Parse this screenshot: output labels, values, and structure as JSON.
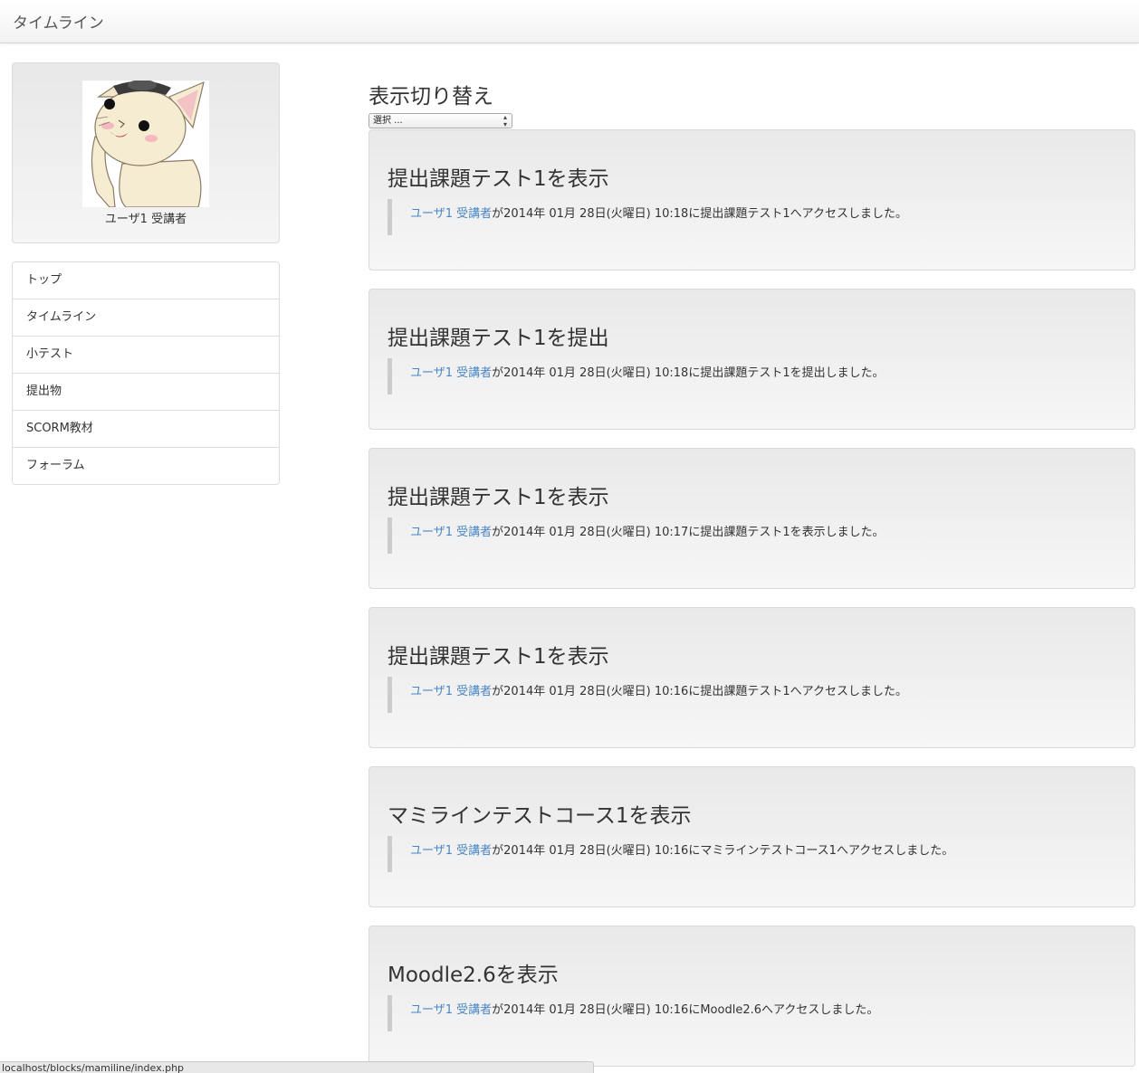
{
  "navbar": {
    "brand": "タイムライン"
  },
  "profile": {
    "name": "ユーザ1 受講者"
  },
  "sidebar": {
    "items": [
      {
        "label": "トップ"
      },
      {
        "label": "タイムライン"
      },
      {
        "label": "小テスト"
      },
      {
        "label": "提出物"
      },
      {
        "label": "SCORM教材"
      },
      {
        "label": "フォーラム"
      }
    ]
  },
  "filter": {
    "title": "表示切り替え",
    "selected": "選択 ..."
  },
  "events": [
    {
      "title": "提出課題テスト1を表示",
      "user": "ユーザ1 受講者",
      "text": "が2014年 01月 28日(火曜日) 10:18に提出課題テスト1へアクセスしました。"
    },
    {
      "title": "提出課題テスト1を提出",
      "user": "ユーザ1 受講者",
      "text": "が2014年 01月 28日(火曜日) 10:18に提出課題テスト1を提出しました。"
    },
    {
      "title": "提出課題テスト1を表示",
      "user": "ユーザ1 受講者",
      "text": "が2014年 01月 28日(火曜日) 10:17に提出課題テスト1を表示しました。"
    },
    {
      "title": "提出課題テスト1を表示",
      "user": "ユーザ1 受講者",
      "text": "が2014年 01月 28日(火曜日) 10:16に提出課題テスト1へアクセスしました。"
    },
    {
      "title": "マミラインテストコース1を表示",
      "user": "ユーザ1 受講者",
      "text": "が2014年 01月 28日(火曜日) 10:16にマミラインテストコース1へアクセスしました。"
    },
    {
      "title": "Moodle2.6を表示",
      "user": "ユーザ1 受講者",
      "text": "が2014年 01月 28日(火曜日) 10:16にMoodle2.6へアクセスしました。"
    }
  ],
  "statusbar": {
    "url": "localhost/blocks/mamiline/index.php"
  }
}
